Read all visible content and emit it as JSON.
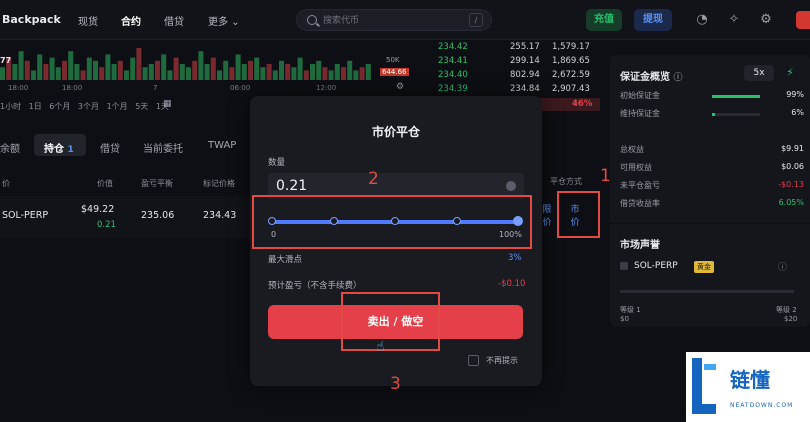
{
  "topbar": {
    "brand": "Backpack",
    "nav": [
      "现货",
      "合约",
      "借贷",
      "更多"
    ],
    "nav_active": 1,
    "search_placeholder": "搜索代币",
    "search_shortcut": "/",
    "deposit_label": "充值",
    "withdraw_label": "提现"
  },
  "chart": {
    "time_labels": [
      "18:00",
      "7",
      "06:00",
      "12:00"
    ],
    "right_labels": [
      "50K",
      "644.66"
    ],
    "value_prefix": "77",
    "timeframes": [
      "1小时",
      "1日",
      "6个月",
      "3个月",
      "1个月",
      "5天",
      "1天"
    ],
    "bar_heights": [
      0.4,
      0.7,
      0.5,
      0.9,
      0.6,
      0.3,
      0.8,
      0.5,
      0.7,
      0.4,
      0.6,
      0.9,
      0.5,
      0.3,
      0.7,
      0.6,
      0.4,
      0.8,
      0.5,
      0.6,
      0.3,
      0.7,
      1.0,
      0.4,
      0.5,
      0.6,
      0.8,
      0.3,
      0.7,
      0.5,
      0.4,
      0.6,
      0.9,
      0.5,
      0.7,
      0.3,
      0.6,
      0.4,
      0.8,
      0.5,
      0.6,
      0.7,
      0.4,
      0.5,
      0.3,
      0.6,
      0.5,
      0.4,
      0.7,
      0.3,
      0.5,
      0.6,
      0.4,
      0.3,
      0.5,
      0.4,
      0.6,
      0.3,
      0.4,
      0.5
    ]
  },
  "orderbook": {
    "rows": [
      [
        "234.42",
        "255.17",
        "1,579.17"
      ],
      [
        "234.41",
        "299.14",
        "1,869.65"
      ],
      [
        "234.40",
        "802.94",
        "2,672.59"
      ],
      [
        "234.39",
        "234.84",
        "2,907.43"
      ]
    ],
    "percent": "46%"
  },
  "positions": {
    "tabs": [
      "余额",
      "持仓",
      "借贷",
      "当前委托",
      "TWAP"
    ],
    "active_tab": 1,
    "position_count": "1",
    "headers": [
      "价",
      "价值",
      "盈亏平衡",
      "标记价格"
    ],
    "row": {
      "symbol": "SOL-PERP",
      "value": "$49.22",
      "value_sub": "0.21",
      "breakeven": "235.06",
      "mark": "234.43"
    },
    "close_method_label": "平仓方式",
    "limit_label": "限价",
    "market_label": "市价"
  },
  "margin": {
    "title": "保证金概览",
    "leverage": "5x",
    "rows": [
      {
        "label": "初始保证金",
        "value": "99%",
        "fill": 0.99
      },
      {
        "label": "维持保证金",
        "value": "6%",
        "fill": 0.06
      }
    ],
    "stats": [
      {
        "label": "总权益",
        "value": "$9.91",
        "color": "#e6e7ec"
      },
      {
        "label": "可用权益",
        "value": "$0.06",
        "color": "#e6e7ec"
      },
      {
        "label": "未平仓盈亏",
        "value": "-$0.13",
        "color": "#e5404a"
      },
      {
        "label": "借贷收益率",
        "value": "6.05%",
        "color": "#29c26b"
      }
    ],
    "reputation_title": "市场声誉",
    "rep_symbol": "SOL-PERP",
    "rep_badge": "黄金",
    "level_left": "等级 1",
    "level_left_val": "$0",
    "level_right": "等级 2",
    "level_right_val": "$20"
  },
  "modal": {
    "title": "市价平仓",
    "qty_label": "数量",
    "qty_value": "0.21",
    "slider_min": "0",
    "slider_max": "100%",
    "slider_value": 1.0,
    "slippage_label": "最大滑点",
    "slippage_value": "3%",
    "pnl_label": "预计盈亏（不含手续费）",
    "pnl_value": "-$0.10",
    "sell_label": "卖出 / 做空",
    "dont_show_label": "不再提示"
  },
  "annotations": [
    "1",
    "2",
    "3"
  ],
  "watermark": {
    "cn": "链懂",
    "en": "NEATDOWN.COM"
  },
  "colors": {
    "accent_blue": "#4f7cff",
    "sell_red": "#e5404a",
    "profit_green": "#29c26b",
    "annot_red": "#e24a44"
  }
}
